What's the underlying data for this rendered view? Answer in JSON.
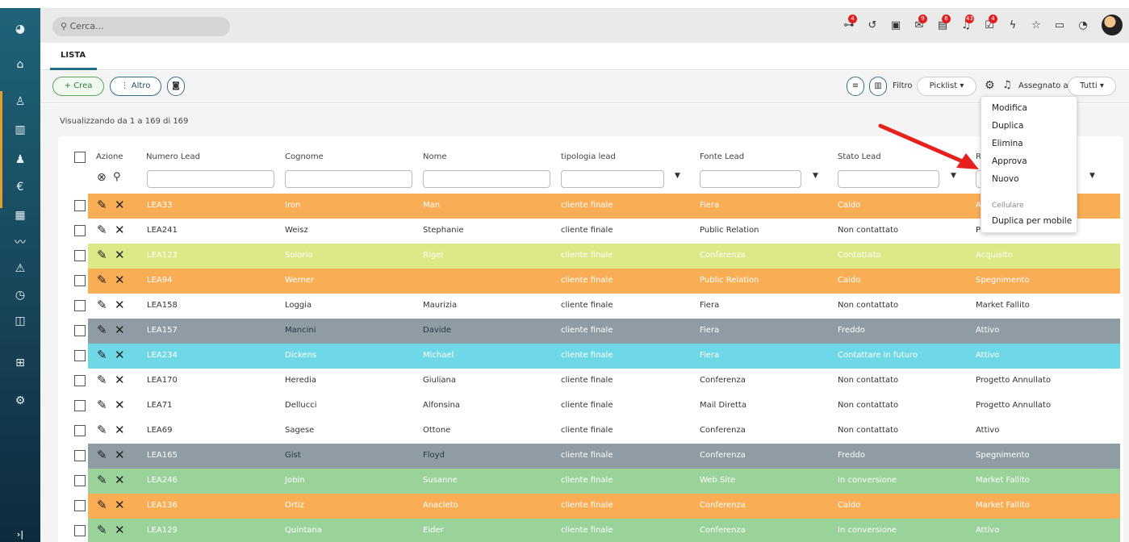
{
  "search": {
    "placeholder": "Cerca..."
  },
  "topbar": {
    "badges": {
      "b0": "4",
      "b3": "9",
      "b4": "6",
      "b5": "43",
      "b6": "4"
    }
  },
  "tabs": {
    "lista": "LISTA"
  },
  "toolbar": {
    "crea": "+ Crea",
    "altro": "⋮ Altro",
    "filtro": "Filtro",
    "picklist": "Picklist ▾",
    "assegnato": "Assegnato a",
    "tutti": "Tutti ▾"
  },
  "info": "Visualizzando da 1 a 169 di 169",
  "columns": [
    "Azione",
    "Numero Lead",
    "Cognome",
    "Nome",
    "tipologia lead",
    "Fonte Lead",
    "Stato Lead",
    "R"
  ],
  "menu": {
    "modifica": "Modifica",
    "duplica": "Duplica",
    "elimina": "Elimina",
    "approva": "Approva",
    "nuovo": "Nuovo",
    "cellulare": "Cellulare",
    "duplica_mobile": "Duplica per mobile"
  },
  "colors": {
    "orange": "#f9ad55",
    "white": "#ffffff",
    "yellowgreen": "#dde887",
    "gray": "#8f9ca3",
    "cyan": "#6fd8e6",
    "green": "#9ad39a"
  },
  "rows": [
    {
      "num": "LEA33",
      "cognome": "Iron",
      "nome": "Man",
      "tipo": "cliente finale",
      "fonte": "Fiera",
      "stato": "Caldo",
      "r": "A",
      "color": "orange"
    },
    {
      "num": "LEA241",
      "cognome": "Weisz",
      "nome": "Stephanie",
      "tipo": "cliente finale",
      "fonte": "Public Relation",
      "stato": "Non contattato",
      "r": "P",
      "color": "white"
    },
    {
      "num": "LEA123",
      "cognome": "Solorio",
      "nome": "Rigel",
      "tipo": "cliente finale",
      "fonte": "Conferenza",
      "stato": "Contattato",
      "r": "Acquisito",
      "color": "yellowgreen"
    },
    {
      "num": "LEA94",
      "cognome": "Werner",
      "nome": "",
      "tipo": "cliente finale",
      "fonte": "Public Relation",
      "stato": "Caldo",
      "r": "Spegnimento",
      "color": "orange"
    },
    {
      "num": "LEA158",
      "cognome": "Loggia",
      "nome": "Maurizia",
      "tipo": "cliente finale",
      "fonte": "Fiera",
      "stato": "Non contattato",
      "r": "Market Fallito",
      "color": "white"
    },
    {
      "num": "LEA157",
      "cognome": "Mancini",
      "nome": "Davide",
      "tipo": "cliente finale",
      "fonte": "Fiera",
      "stato": "Freddo",
      "r": "Attivo",
      "color": "gray"
    },
    {
      "num": "LEA234",
      "cognome": "Dickens",
      "nome": "Michael",
      "tipo": "cliente finale",
      "fonte": "Fiera",
      "stato": "Contattare in futuro",
      "r": "Attivo",
      "color": "cyan"
    },
    {
      "num": "LEA170",
      "cognome": "Heredia",
      "nome": "Giuliana",
      "tipo": "cliente finale",
      "fonte": "Conferenza",
      "stato": "Non contattato",
      "r": "Progetto Annullato",
      "color": "white"
    },
    {
      "num": "LEA71",
      "cognome": "Dellucci",
      "nome": "Alfonsina",
      "tipo": "cliente finale",
      "fonte": "Mail Diretta",
      "stato": "Non contattato",
      "r": "Progetto Annullato",
      "color": "white"
    },
    {
      "num": "LEA69",
      "cognome": "Sagese",
      "nome": "Ottone",
      "tipo": "cliente finale",
      "fonte": "Conferenza",
      "stato": "Non contattato",
      "r": "Attivo",
      "color": "white"
    },
    {
      "num": "LEA165",
      "cognome": "Gist",
      "nome": "Floyd",
      "tipo": "cliente finale",
      "fonte": "Conferenza",
      "stato": "Freddo",
      "r": "Spegnimento",
      "color": "gray"
    },
    {
      "num": "LEA246",
      "cognome": "Jobin",
      "nome": "Susanne",
      "tipo": "cliente finale",
      "fonte": "Web Site",
      "stato": "In conversione",
      "r": "Market Fallito",
      "color": "green"
    },
    {
      "num": "LEA136",
      "cognome": "Ortiz",
      "nome": "Anacleto",
      "tipo": "cliente finale",
      "fonte": "Conferenza",
      "stato": "Caldo",
      "r": "Market Fallito",
      "color": "orange"
    },
    {
      "num": "LEA129",
      "cognome": "Quintana",
      "nome": "Eider",
      "tipo": "cliente finale",
      "fonte": "Conferenza",
      "stato": "In conversione",
      "r": "Attivo",
      "color": "green"
    }
  ]
}
